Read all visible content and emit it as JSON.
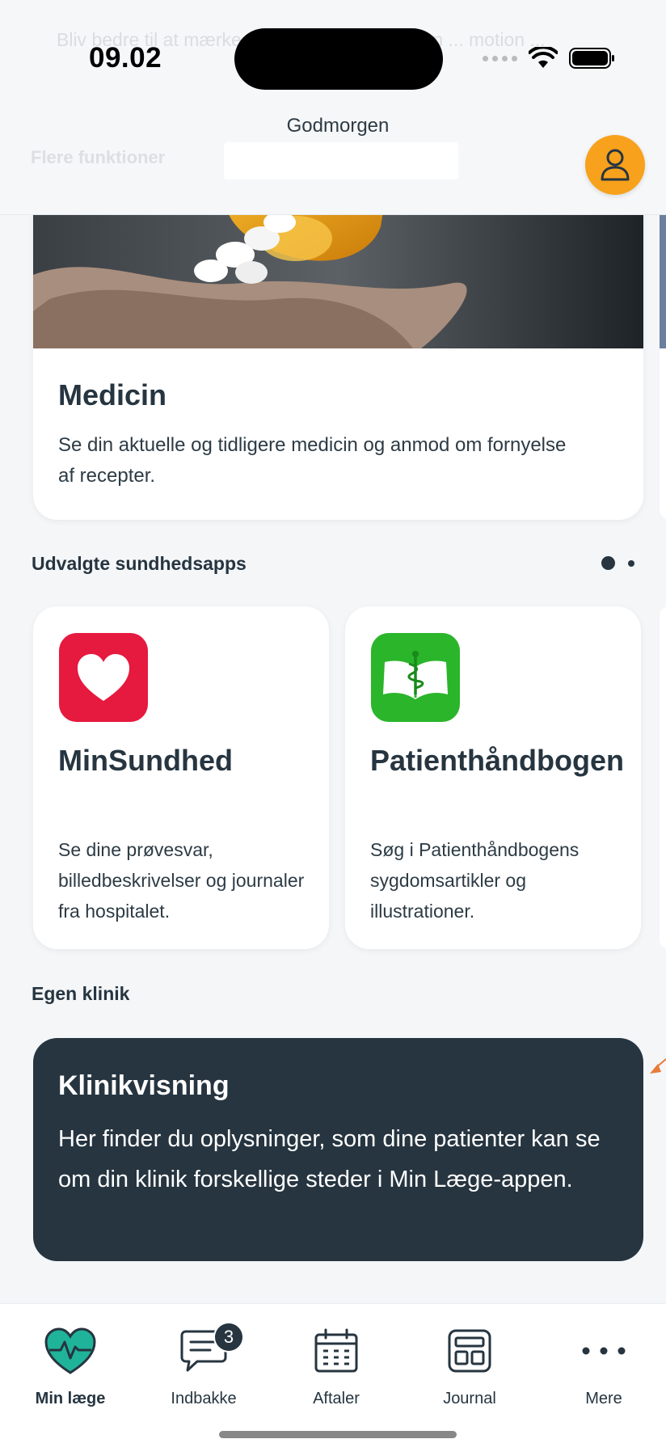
{
  "status_bar": {
    "time": "09.02"
  },
  "header": {
    "greeting": "Godmorgen",
    "ghost_text": "Bliv bedre til at mærke ... hvordan faktorer som ... motion ...",
    "ghost_more": "Flere funktioner"
  },
  "medicin_card": {
    "title": "Medicin",
    "description": "Se din aktuelle og tidligere medicin og anmod om fornyelse af recepter."
  },
  "apps_section": {
    "title": "Udvalgte sundhedsapps",
    "apps": [
      {
        "name": "MinSundhed",
        "description": "Se dine prøvesvar, billedbeskrivelser og journaler fra hospitalet.",
        "icon": "heart-icon",
        "color": "#e6193f"
      },
      {
        "name": "Patienthåndbogen",
        "description": "Søg i Patienthåndbogens sygdomsartikler og illustrationer.",
        "icon": "book-icon",
        "color": "#2bb52b"
      }
    ]
  },
  "clinic_section": {
    "title": "Egen klinik",
    "card_title": "Klinikvisning",
    "card_description": "Her finder du oplysninger, som dine patienter kan se om din klinik forskellige steder i Min Læge-appen."
  },
  "tabbar": {
    "tabs": [
      {
        "label": "Min læge",
        "icon": "heart-pulse-icon",
        "active": true
      },
      {
        "label": "Indbakke",
        "icon": "chat-icon",
        "badge": "3"
      },
      {
        "label": "Aftaler",
        "icon": "calendar-icon"
      },
      {
        "label": "Journal",
        "icon": "journal-icon"
      },
      {
        "label": "Mere",
        "icon": "more-icon"
      }
    ]
  },
  "colors": {
    "accent": "#f7a11c",
    "dark": "#263540",
    "heart": "#e6193f",
    "green": "#2bb52b",
    "teal": "#1fb39a"
  }
}
